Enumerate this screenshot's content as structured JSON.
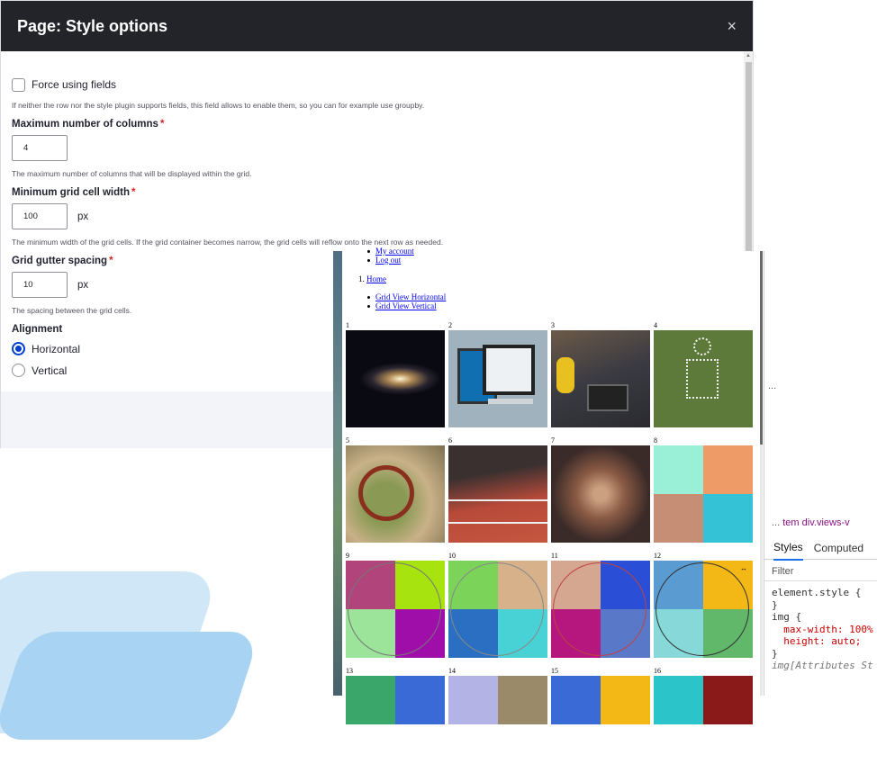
{
  "modal": {
    "title": "Page: Style options",
    "close_glyph": "×",
    "force_fields": {
      "label": "Force using fields",
      "description": "If neither the row nor the style plugin supports fields, this field allows to enable them, so you can for example use groupby."
    },
    "max_columns": {
      "label": "Maximum number of columns",
      "required": "*",
      "value": "4",
      "description": "The maximum number of columns that will be displayed within the grid."
    },
    "min_width": {
      "label": "Minimum grid cell width",
      "required": "*",
      "value": "100",
      "unit": "px",
      "description": "The minimum width of the grid cells. If the grid container becomes narrow, the grid cells will reflow onto the next row as needed."
    },
    "gutter": {
      "label": "Grid gutter spacing",
      "required": "*",
      "value": "10",
      "unit": "px",
      "description": "The spacing between the grid cells."
    },
    "alignment": {
      "label": "Alignment",
      "options": [
        "Horizontal",
        "Vertical"
      ],
      "selected": "Horizontal"
    }
  },
  "preview": {
    "menu_links": [
      "My account",
      "Log out"
    ],
    "breadcrumb_number": "1.",
    "breadcrumb": "Home",
    "view_links": [
      "Grid View Horizontal",
      "Grid View Vertical"
    ],
    "grid_items": [
      "1",
      "2",
      "3",
      "4",
      "5",
      "6",
      "7",
      "8",
      "9",
      "10",
      "11",
      "12",
      "13",
      "14",
      "15",
      "16"
    ]
  },
  "devtools": {
    "more": "...",
    "breadcrumb": [
      "...",
      "tem",
      "div.views-v"
    ],
    "tabs": [
      "Styles",
      "Computed"
    ],
    "filter_placeholder": "Filter",
    "code": [
      "element.style {",
      "}",
      "img {",
      "max-width: 100%",
      "height: auto;",
      "}",
      "img[Attributes St"
    ]
  },
  "colors": {
    "modal_header": "#232429",
    "radio_selected": "#003ecc",
    "required": "#dc2323",
    "link": "#0000ee",
    "devtools_tag": "#881280",
    "devtools_prop": "#c80000"
  }
}
